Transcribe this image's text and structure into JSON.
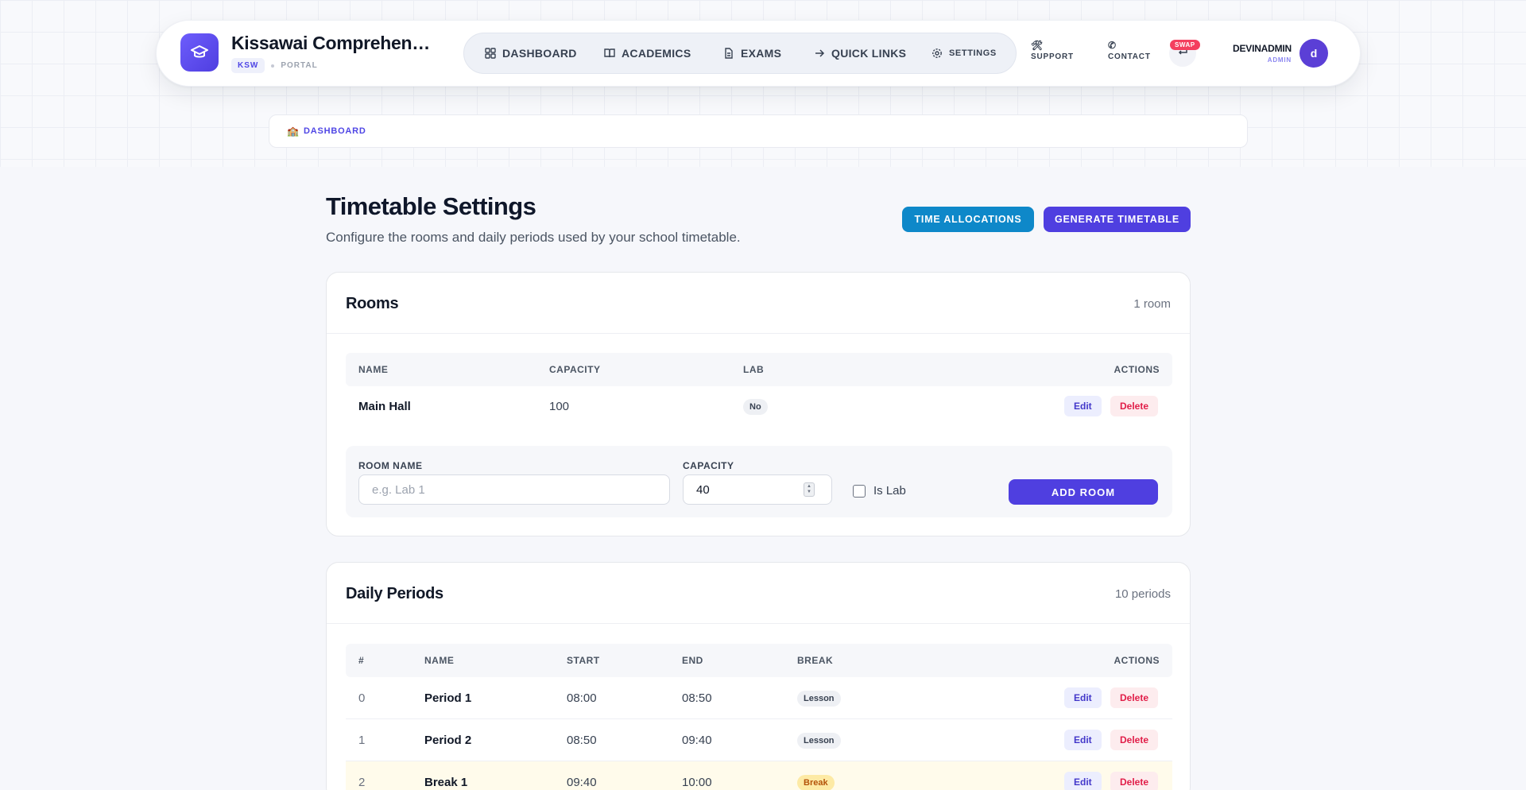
{
  "header": {
    "school_name": "Kissawai Comprehensive School",
    "code": "KSW",
    "portal_label": "PORTAL",
    "nav": {
      "dashboard": "DASHBOARD",
      "academics": "ACADEMICS",
      "exams": "EXAMS",
      "quick_links": "QUICK LINKS",
      "settings": "SETTINGS"
    },
    "support": "SUPPORT",
    "contact": "CONTACT",
    "swap_badge": "SWAP",
    "user_name": "DEVINADMIN",
    "user_role": "ADMIN",
    "avatar_initial": "d"
  },
  "breadcrumb": {
    "icon": "🏫",
    "label": "DASHBOARD"
  },
  "page": {
    "title": "Timetable Settings",
    "subtitle": "Configure the rooms and daily periods used by your school timetable.",
    "time_allocations_btn": "TIME ALLOCATIONS",
    "generate_btn": "GENERATE TIMETABLE"
  },
  "rooms": {
    "title": "Rooms",
    "count": "1 room",
    "columns": {
      "name": "NAME",
      "capacity": "CAPACITY",
      "lab": "LAB",
      "actions": "ACTIONS"
    },
    "rows": [
      {
        "name": "Main Hall",
        "capacity": "100",
        "lab": "No",
        "edit": "Edit",
        "delete": "Delete"
      }
    ],
    "form": {
      "room_name_label": "ROOM NAME",
      "room_name_placeholder": "e.g. Lab 1",
      "capacity_label": "CAPACITY",
      "capacity_value": "40",
      "is_lab_label": "Is Lab",
      "add_btn": "ADD ROOM"
    }
  },
  "periods": {
    "title": "Daily Periods",
    "count": "10 periods",
    "columns": {
      "num": "#",
      "name": "NAME",
      "start": "START",
      "end": "END",
      "break": "BREAK",
      "actions": "ACTIONS"
    },
    "rows": [
      {
        "num": "0",
        "name": "Period 1",
        "start": "08:00",
        "end": "08:50",
        "type": "Lesson",
        "edit": "Edit",
        "delete": "Delete"
      },
      {
        "num": "1",
        "name": "Period 2",
        "start": "08:50",
        "end": "09:40",
        "type": "Lesson",
        "edit": "Edit",
        "delete": "Delete"
      },
      {
        "num": "2",
        "name": "Break 1",
        "start": "09:40",
        "end": "10:00",
        "type": "Break",
        "edit": "Edit",
        "delete": "Delete"
      }
    ]
  },
  "colors": {
    "accent": "#4f3fe0",
    "sky": "#0e88c9",
    "danger": "#e11d48",
    "break_row": "#fffbeb"
  }
}
